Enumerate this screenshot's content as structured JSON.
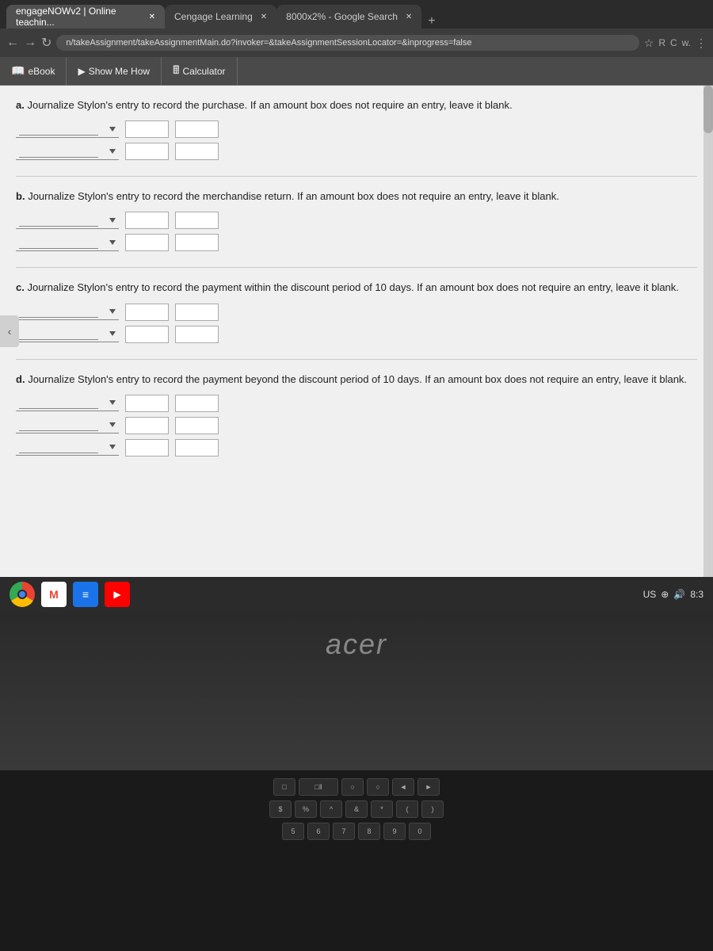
{
  "browser": {
    "tabs": [
      {
        "id": 1,
        "label": "engageNOWv2 | Online teachin...",
        "active": true
      },
      {
        "id": 2,
        "label": "Cengage Learning",
        "active": false
      },
      {
        "id": 3,
        "label": "8000x2% - Google Search",
        "active": false
      }
    ],
    "address": "n/takeAssignment/takeAssignmentMain.do?invoker=&takeAssignmentSessionLocator=&inprogress=false",
    "new_tab_label": "+"
  },
  "toolbar": {
    "ebook_label": "eBook",
    "show_me_how_label": "Show Me How",
    "calculator_label": "Calculator"
  },
  "sections": {
    "a": {
      "label": "a.",
      "text": "Journalize Stylon's entry to record the purchase. If an amount box does not require an entry, leave it blank.",
      "rows": 2
    },
    "b": {
      "label": "b.",
      "text": "Journalize Stylon's entry to record the merchandise return. If an amount box does not require an entry, leave it blank.",
      "rows": 2
    },
    "c": {
      "label": "c.",
      "text": "Journalize Stylon's entry to record the payment within the discount period of 10 days. If an amount box does not require an entry, leave it blank.",
      "rows": 2
    },
    "d": {
      "label": "d.",
      "text": "Journalize Stylon's entry to record the payment beyond the discount period of 10 days. If an amount box does not require an entry, leave it blank.",
      "rows": 3
    }
  },
  "taskbar": {
    "time": "8:3",
    "region": "US"
  },
  "laptop": {
    "logo": "acer"
  }
}
